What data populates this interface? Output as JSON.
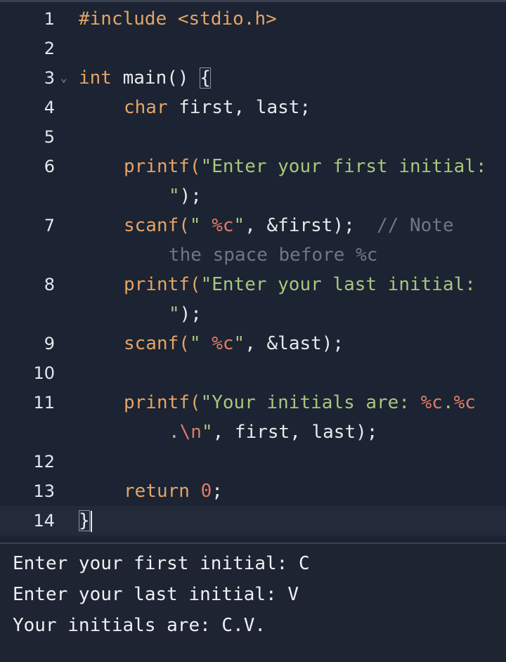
{
  "editor": {
    "line_numbers": [
      "1",
      "2",
      "3",
      "4",
      "5",
      "6",
      "7",
      "8",
      "9",
      "10",
      "11",
      "12",
      "13",
      "14"
    ],
    "line1": {
      "include": "#include <stdio.h>"
    },
    "line3": {
      "type": "int",
      "rest": " main() ",
      "brace": "{"
    },
    "line4": {
      "type": "char",
      "rest": " first, last;"
    },
    "line6": {
      "fn": "printf(",
      "str_a": "\"Enter your first initial:",
      "str_b": "\"",
      "end": ");"
    },
    "line7": {
      "fn": "scanf(",
      "str1": "\" ",
      "fmt": "%c",
      "str2": "\"",
      "rest": ", &first);",
      "comment_a": "// Note",
      "comment_b": "the space before %c"
    },
    "line8": {
      "fn": "printf(",
      "str_a": "\"Enter your last initial:",
      "str_b": "\"",
      "end": ");"
    },
    "line9": {
      "fn": "scanf(",
      "str1": "\" ",
      "fmt": "%c",
      "str2": "\"",
      "rest": ", &last);"
    },
    "line11": {
      "fn": "printf(",
      "str_a": "\"Your initials are: ",
      "fmt_a": "%c",
      "dot": ".",
      "fmt_b": "%c",
      "cont_a": ".",
      "esc": "\\n",
      "cont_b": "\"",
      "rest": ", first, last);"
    },
    "line13": {
      "kw": "return",
      "num": "0",
      "end": ";"
    },
    "line14": {
      "brace": "}"
    },
    "fold_marker": "⌄"
  },
  "console": {
    "lines": [
      "Enter your first initial: C",
      "Enter your last initial: V",
      "Your initials are: C.V."
    ]
  }
}
